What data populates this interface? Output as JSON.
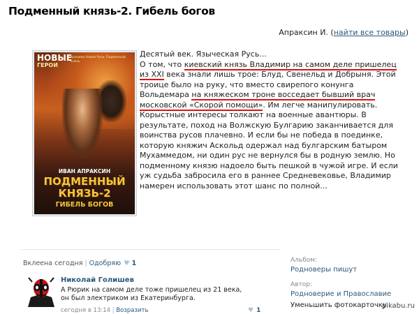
{
  "header": {
    "title": "Подменный князь-2. Гибель богов",
    "author": "Апраксин И.",
    "all_goods_link": "найти все товары"
  },
  "cover": {
    "series_top": "НОВЫЕ",
    "series_bottom": "ГЕРОИ",
    "tagline": "Хроники Новой Руси. Подменный князь",
    "author": "ИВАН АПРАКСИН",
    "title_line1": "ПОДМЕННЫЙ",
    "title_line2": "КНЯЗЬ-2",
    "subtitle": "ГИБЕЛЬ БОГОВ"
  },
  "description": {
    "p1": "Десятый век. Языческая Русь...",
    "p2_a": "О том, что ",
    "p2_hl1": "киевский князь Владимир на самом деле пришелец из XXI",
    "p2_b": " века знали лишь трое: Блуд, Свенельд и Добрыня. Этой троице было на руку, что вместо свирепого конунга Вольдемара ",
    "p2_hl2": "на княжеском троне восседает бывший врач московской «Скорой помощи»",
    "p2_c": ". Им легче манипулировать. Корыстные интересы толкают на военные авантюры. В результате, поход на Волжскую Булгарию заканчивается для воинства русов плачевно. И если бы не победа в поединке, которую княжич Аскольд одержал над булгарским батыром Мухаммедом, ни один рус не вернулся бы в родную землю. Но подменному князю надоело быть пешкой в чужой игре. И если уж судьба забросила его в раннее Средневековье, Владимир намерен использовать этот шанс по полной..."
  },
  "post_meta": {
    "seen": "Вклеена сегодня",
    "approve": "Одобряю",
    "likes": "1"
  },
  "comment": {
    "name": "Николай Голишев",
    "text": "А Рюрик на самом деле тоже пришелец из 21 века, он был электриком из Екатеринбурга.",
    "date": "сегодня в 13:14",
    "reply": "Возразить",
    "likes": "1"
  },
  "sidebar": {
    "album_label": "Альбом:",
    "album_value": "Родноверы пишут",
    "author_label": "Автор:",
    "author_value": "Родноверие и Православие",
    "shrink": "Уменьшить фотокарточку"
  },
  "watermark": "pikabu.ru",
  "colors": {
    "link": "#2b587a",
    "highlight": "#dd1111"
  }
}
